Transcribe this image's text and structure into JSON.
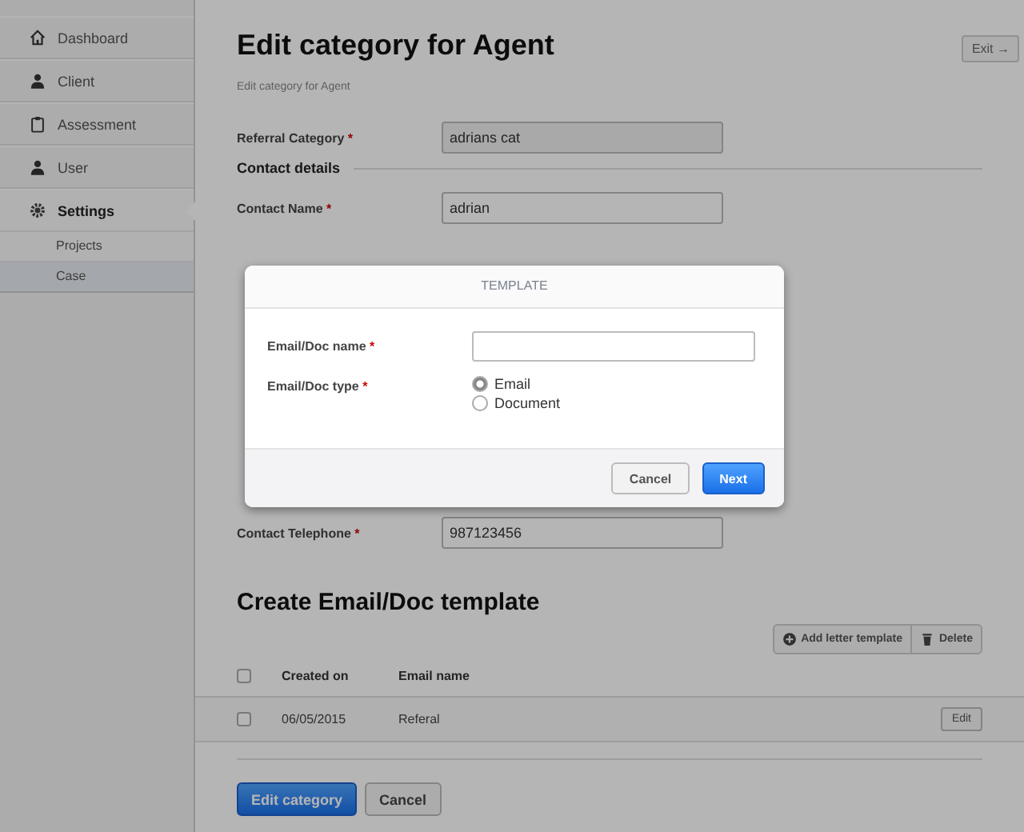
{
  "sidebar": {
    "items": [
      {
        "label": "Dashboard",
        "selected": false
      },
      {
        "label": "Client",
        "selected": false
      },
      {
        "label": "Assessment",
        "selected": false
      },
      {
        "label": "User",
        "selected": false
      },
      {
        "label": "Settings",
        "selected": true,
        "children": [
          {
            "label": "Projects",
            "selected": false
          },
          {
            "label": "Case",
            "selected": true
          }
        ]
      }
    ]
  },
  "page": {
    "title": "Edit category for Agent",
    "breadcrumb": "Edit category for Agent",
    "exit_button": "Exit →"
  },
  "form": {
    "top_fields": [
      {
        "label": "Referral Category",
        "mark": "*",
        "value": "adrians cat",
        "disabled": true
      }
    ],
    "section": "Contact details",
    "contact_fields": [
      {
        "label": "Contact Name",
        "mark": "*",
        "value": "adrian",
        "disabled": false
      }
    ],
    "bottom_fields": [
      {
        "label": "Contact Telephone",
        "mark": "*",
        "value": "987123456",
        "disabled": false
      }
    ]
  },
  "templates": {
    "title": "Create Email/Doc template",
    "toolbar": [
      {
        "label": "Add letter template"
      },
      {
        "label": "Delete"
      }
    ],
    "columns": [
      "Created on",
      "Email name"
    ],
    "header_checked": false,
    "rows": [
      {
        "checked": false,
        "created_on": "06/05/2015",
        "email_name": "Referal",
        "action": "Edit"
      }
    ]
  },
  "actions": [
    {
      "label": "Edit category",
      "kind": "primary"
    },
    {
      "label": "Cancel",
      "kind": "default"
    }
  ],
  "modal": {
    "title": "TEMPLATE",
    "name_label": "Email/Doc name",
    "name_mark": "*",
    "type_label": "Email/Doc type",
    "type_mark": "*",
    "options": [
      {
        "label": "Email",
        "selected": true
      },
      {
        "label": "Document",
        "selected": false
      }
    ],
    "buttons": [
      {
        "label": "Cancel",
        "kind": "default"
      },
      {
        "label": "Next",
        "kind": "primary"
      }
    ]
  }
}
